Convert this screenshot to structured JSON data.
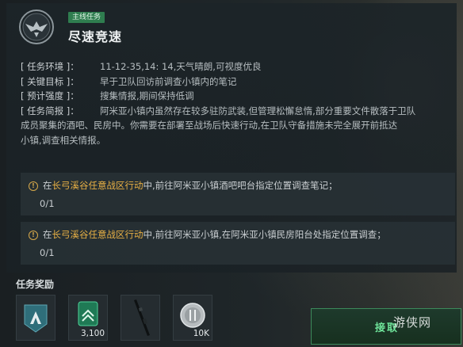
{
  "header": {
    "tag": "主线任务",
    "title": "尽速竞速"
  },
  "info": [
    {
      "key": "[ 任务环境 ]：",
      "value": "11-12-35,14: 14,天气晴朗,可视度优良"
    },
    {
      "key": "[ 关键目标 ]：",
      "value": "早于卫队回访前调查小镇内的笔记"
    },
    {
      "key": "[ 预计强度 ]：",
      "value": "搜集情报,期间保持低调"
    },
    {
      "key": "[ 任务简报 ]：",
      "value": "阿米亚小镇内虽然存在较多驻防武装,但管理松懈怠惰,部分重要文件散落于卫队"
    }
  ],
  "brief_continued": [
    "成员聚集的酒吧、民房中。你需要在部署至战场后快速行动,在卫队守备措施未完全展开前抵达",
    "小镇,调查相关情报。"
  ],
  "tasks": [
    {
      "prefix": "在",
      "highlight": "长弓溪谷任意战区行动",
      "suffix": "中,前往阿米亚小镇酒吧吧台指定位置调查笔记；",
      "progress": "0/1"
    },
    {
      "prefix": "在",
      "highlight": "长弓溪谷任意战区行动",
      "suffix": "中,前往阿米亚小镇,在阿米亚小镇民房阳台处指定位置调查；",
      "progress": "0/1"
    }
  ],
  "rewards": {
    "title": "任务奖励",
    "items": [
      {
        "icon": "faction-badge-icon",
        "count": ""
      },
      {
        "icon": "experience-card-icon",
        "count": "3,100"
      },
      {
        "icon": "rifle-icon",
        "count": ""
      },
      {
        "icon": "coin-icon",
        "count": "10K"
      }
    ]
  },
  "claim_button": "接取",
  "watermark": "游侠网",
  "colors": {
    "accent_green": "#2f7d4f",
    "claim_text": "#6fe49a",
    "highlight": "#e8b045"
  }
}
